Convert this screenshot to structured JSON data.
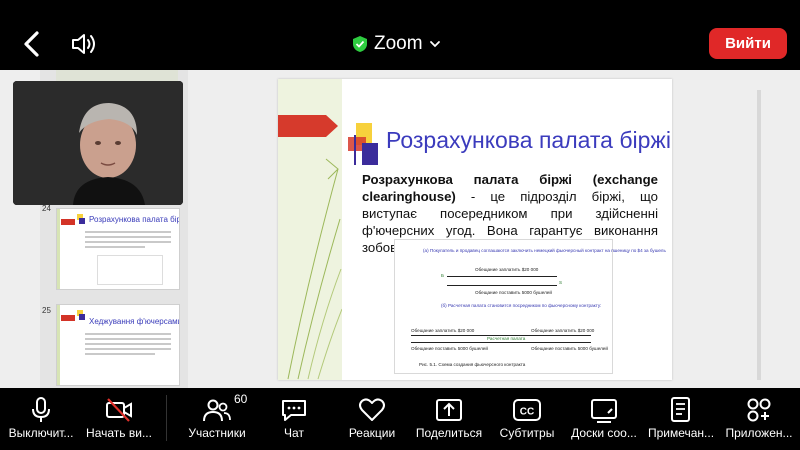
{
  "header": {
    "title": "Zoom",
    "leave_label": "Вийти"
  },
  "slides_panel": {
    "thumbnails": [
      {
        "number": "24",
        "title": "Розрахункова палата біржі"
      },
      {
        "number": "25",
        "title": "Хеджування ф'ючерсами"
      }
    ]
  },
  "slide": {
    "title": "Розрахункова палата біржі",
    "term": "Розрахункова палата біржі (exchange clearinghouse)",
    "text": " - це підрозділ біржі, що виступає посередником при здійсненні ф'ючерсних угод. Вона гарантує виконання зобов'язань кожної зі сторін угоди.",
    "diagram": {
      "line_a": "(а) Покупатель и продавец соглашаются заключить немецкий фьючерсный контракт на пшеницу по $4 за бушель",
      "pay": "Обещание заплатить $20 000",
      "deliver": "Обещание поставить 5000 бушелей",
      "line_b": "(б) Расчетная палата становится посредником по фьючерсному контракту:",
      "pay_left": "Обещание заплатить $20 000",
      "pay_right": "Обещание заплатить $20 000",
      "clearing": "Расчетная палата",
      "deliver_left": "Обещание поставить 5000 бушелей",
      "deliver_right": "Обещание поставить 5000 бушелей",
      "party_b": "Б",
      "party_s": "S",
      "caption": "Рис. 5.1. Схема создания фьючерсного контракта"
    }
  },
  "toolbar": {
    "participants_count": "60",
    "items": [
      {
        "label": "Выключит..."
      },
      {
        "label": "Начать ви..."
      },
      {
        "label": "Участники"
      },
      {
        "label": "Чат"
      },
      {
        "label": "Реакции"
      },
      {
        "label": "Поделиться"
      },
      {
        "label": "Субтитры"
      },
      {
        "label": "Доски соо..."
      },
      {
        "label": "Примечан..."
      },
      {
        "label": "Приложен..."
      }
    ]
  },
  "colors": {
    "leave_button": "#e02828",
    "shield_green": "#2ecc40",
    "slide_title_blue": "#3b3bbd",
    "video_off_red": "#e0312b"
  }
}
